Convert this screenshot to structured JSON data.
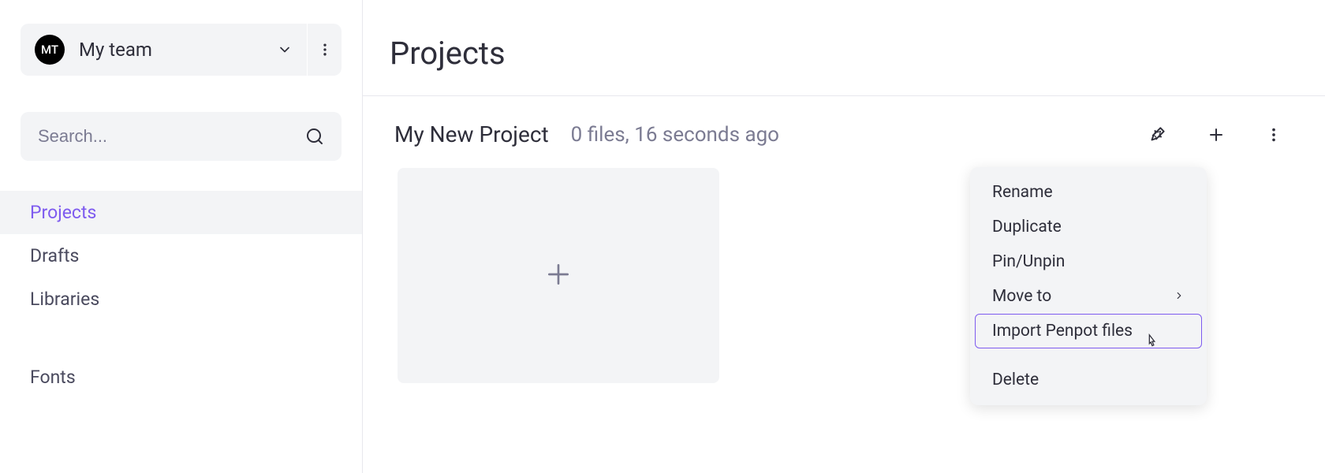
{
  "team": {
    "avatar_initials": "MT",
    "name": "My team"
  },
  "search": {
    "placeholder": "Search..."
  },
  "sidebar": {
    "items": [
      {
        "label": "Projects",
        "active": true
      },
      {
        "label": "Drafts",
        "active": false
      },
      {
        "label": "Libraries",
        "active": false
      }
    ],
    "fonts_label": "Fonts"
  },
  "main": {
    "title": "Projects"
  },
  "project": {
    "name": "My New Project",
    "meta": "0 files, 16 seconds ago"
  },
  "context_menu": {
    "items": [
      {
        "label": "Rename",
        "submenu": false,
        "highlighted": false
      },
      {
        "label": "Duplicate",
        "submenu": false,
        "highlighted": false
      },
      {
        "label": "Pin/Unpin",
        "submenu": false,
        "highlighted": false
      },
      {
        "label": "Move to",
        "submenu": true,
        "highlighted": false
      },
      {
        "label": "Import Penpot files",
        "submenu": false,
        "highlighted": true
      },
      {
        "label": "Delete",
        "submenu": false,
        "highlighted": false
      }
    ]
  },
  "colors": {
    "accent": "#7e5bef",
    "muted_bg": "#f3f4f6",
    "text": "#2e2e3a",
    "subtext": "#7b7b92"
  }
}
